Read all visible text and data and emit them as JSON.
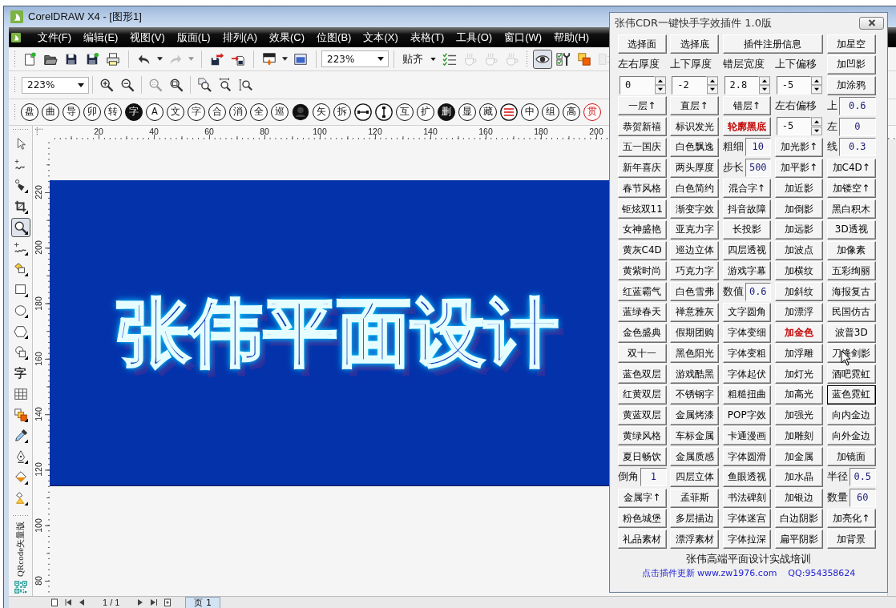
{
  "window": {
    "title": "CorelDRAW X4 - [图形1]"
  },
  "menu_bar": [
    "文件(F)",
    "编辑(E)",
    "视图(V)",
    "版面(L)",
    "排列(A)",
    "效果(C)",
    "位图(B)",
    "文本(X)",
    "表格(T)",
    "工具(O)",
    "窗口(W)",
    "帮助(H)"
  ],
  "standard_toolbar": [
    {
      "kind": "new-document",
      "disabled": false,
      "pressed": false
    },
    {
      "kind": "folder",
      "disabled": false,
      "pressed": false
    },
    {
      "kind": "floppy",
      "disabled": false,
      "pressed": false
    },
    {
      "kind": "floppy-plus",
      "disabled": false,
      "pressed": false
    },
    {
      "kind": "printer",
      "disabled": false,
      "pressed": false
    },
    {
      "kind": "separator"
    },
    {
      "kind": "undo-arrow",
      "disabled": false,
      "pressed": false
    },
    {
      "kind": "caret",
      "disabled": false
    },
    {
      "kind": "redo-arrow",
      "disabled": true,
      "pressed": false
    },
    {
      "kind": "caret",
      "disabled": true
    },
    {
      "kind": "separator"
    },
    {
      "kind": "floppy-arrow",
      "disabled": false,
      "pressed": false
    },
    {
      "kind": "page-arrow",
      "disabled": false,
      "pressed": false
    },
    {
      "kind": "separator"
    },
    {
      "kind": "screen-flame",
      "disabled": false,
      "pressed": false
    },
    {
      "kind": "caret",
      "disabled": false
    },
    {
      "kind": "window",
      "disabled": false,
      "pressed": false
    },
    {
      "kind": "separator"
    },
    {
      "kind": "combo",
      "value": "223%"
    },
    {
      "kind": "separator"
    },
    {
      "kind": "menu",
      "label": "贴齐"
    },
    {
      "kind": "checklist",
      "disabled": false,
      "pressed": false
    },
    {
      "kind": "cup",
      "disabled": true,
      "pressed": false
    },
    {
      "kind": "cup",
      "disabled": true,
      "pressed": false
    },
    {
      "kind": "cup",
      "disabled": true,
      "pressed": false
    },
    {
      "kind": "grip"
    },
    {
      "kind": "eye",
      "disabled": false,
      "pressed": true
    },
    {
      "kind": "checklist-wrench",
      "disabled": false,
      "pressed": false
    },
    {
      "kind": "overlap-squares",
      "disabled": false,
      "pressed": false
    },
    {
      "kind": "side-panel",
      "disabled": true,
      "pressed": false
    }
  ],
  "zoom_toolbar": [
    {
      "kind": "combo",
      "value": "223%"
    },
    {
      "kind": "separator"
    },
    {
      "kind": "magnifier-plus",
      "disabled": false,
      "pressed": false
    },
    {
      "kind": "magnifier-minus",
      "disabled": false,
      "pressed": false
    },
    {
      "kind": "separator"
    },
    {
      "kind": "magnifier-grid",
      "disabled": true,
      "pressed": false
    },
    {
      "kind": "magnifier-rect",
      "disabled": false,
      "pressed": false
    },
    {
      "kind": "separator"
    },
    {
      "kind": "page-magnifier",
      "disabled": false,
      "pressed": false
    },
    {
      "kind": "magnifier-hbar",
      "disabled": false,
      "pressed": false
    },
    {
      "kind": "magnifier-vbar",
      "disabled": false,
      "pressed": false
    }
  ],
  "symbol_toolbar": [
    {
      "kind": "char",
      "text": "盘"
    },
    {
      "kind": "char",
      "text": "曲"
    },
    {
      "kind": "char",
      "text": "导"
    },
    {
      "kind": "char",
      "text": "卯"
    },
    {
      "kind": "char",
      "text": "转"
    },
    {
      "kind": "filled",
      "text": "字"
    },
    {
      "kind": "char",
      "text": "A"
    },
    {
      "kind": "char",
      "text": "文"
    },
    {
      "kind": "char",
      "text": "字"
    },
    {
      "kind": "char",
      "text": "合"
    },
    {
      "kind": "char",
      "text": "消"
    },
    {
      "kind": "char",
      "text": "全"
    },
    {
      "kind": "char",
      "text": "巡"
    },
    {
      "kind": "person"
    },
    {
      "kind": "char",
      "text": "矢"
    },
    {
      "kind": "char",
      "text": "拆"
    },
    {
      "kind": "link"
    },
    {
      "kind": "ibeam"
    },
    {
      "kind": "char",
      "text": "互"
    },
    {
      "kind": "char",
      "text": "扩"
    },
    {
      "kind": "filled",
      "text": "删"
    },
    {
      "kind": "char",
      "text": "显"
    },
    {
      "kind": "char",
      "text": "藏"
    },
    {
      "kind": "lines"
    },
    {
      "kind": "char",
      "text": "中"
    },
    {
      "kind": "char",
      "text": "组"
    },
    {
      "kind": "char",
      "text": "高"
    },
    {
      "kind": "red",
      "text": "贯"
    }
  ],
  "toolbox": [
    {
      "kind": "arrow-pointer",
      "selected": false
    },
    {
      "kind": "node-squiggle",
      "selected": false
    },
    {
      "kind": "nib-node",
      "selected": false
    },
    {
      "kind": "crop",
      "selected": false
    },
    {
      "kind": "magnifier",
      "selected": true
    },
    {
      "kind": "squiggle",
      "selected": false
    },
    {
      "kind": "bucket-square",
      "selected": false
    },
    {
      "kind": "rectangle",
      "selected": false
    },
    {
      "kind": "ellipse",
      "selected": false
    },
    {
      "kind": "hexagon",
      "selected": false
    },
    {
      "kind": "circle-square",
      "selected": false
    },
    {
      "kind": "text",
      "label": "字",
      "selected": false
    },
    {
      "kind": "grid",
      "selected": false
    },
    {
      "kind": "stacked-squares",
      "selected": false
    },
    {
      "kind": "eyedropper",
      "selected": false
    },
    {
      "kind": "pen-nib",
      "selected": false
    },
    {
      "kind": "paint-bucket",
      "selected": false
    },
    {
      "kind": "bucket-triangle",
      "selected": false
    }
  ],
  "toolbox_plugin": {
    "label": "QRcode矢量版"
  },
  "rulers": {
    "horizontal": [
      "20",
      "40",
      "60",
      "80",
      "100",
      "120",
      "140",
      "160",
      "180",
      "200"
    ],
    "vertical": [
      "220",
      "200",
      "180",
      "160",
      "140",
      "120",
      "100",
      "80"
    ]
  },
  "canvas": {
    "artwork_text": "张伟平面设计"
  },
  "page_navigator": {
    "page_count": "1 / 1",
    "page_tab": "页 1"
  },
  "plugin_panel": {
    "title": "张伟CDR一键快手字效插件 1.0版",
    "rows": [
      [
        {
          "kind": "button",
          "label": "选择面",
          "focused": false
        },
        {
          "kind": "button",
          "label": "选择底",
          "focused": false
        },
        {
          "kind": "button",
          "label": "插件注册信息",
          "focused": false,
          "colspan": 2
        },
        {
          "kind": "button",
          "label": "加星空",
          "focused": false
        }
      ],
      [
        {
          "kind": "label",
          "label": "左右厚度"
        },
        {
          "kind": "label",
          "label": "上下厚度"
        },
        {
          "kind": "label",
          "label": "错层宽度"
        },
        {
          "kind": "label",
          "label": "上下偏移"
        },
        {
          "kind": "button",
          "label": "加凹影",
          "focused": false
        }
      ],
      [
        {
          "kind": "spinner",
          "value": "0"
        },
        {
          "kind": "spinner",
          "value": "-2"
        },
        {
          "kind": "spinner",
          "value": "2.8"
        },
        {
          "kind": "spinner",
          "value": "-5"
        },
        {
          "kind": "button",
          "label": "加涂鸦",
          "focused": false
        }
      ],
      [
        {
          "kind": "button",
          "label": "一层↑",
          "focused": false
        },
        {
          "kind": "button",
          "label": "直层↑",
          "focused": false
        },
        {
          "kind": "button",
          "label": "错层↑",
          "focused": false
        },
        {
          "kind": "label",
          "label": "左右偏移"
        },
        {
          "kind": "field",
          "label": "上",
          "value": "0.6"
        }
      ],
      [
        {
          "kind": "button",
          "label": "恭贺新禧",
          "focused": false
        },
        {
          "kind": "button",
          "label": "标识发光",
          "focused": false
        },
        {
          "kind": "button",
          "label": "轮廓黑底",
          "focused": false,
          "color": "#c00000"
        },
        {
          "kind": "spinner",
          "value": "-5"
        },
        {
          "kind": "field",
          "label": "左",
          "value": "0"
        }
      ],
      [
        {
          "kind": "button",
          "label": "五一国庆",
          "focused": false
        },
        {
          "kind": "button",
          "label": "白色飘逸",
          "focused": false
        },
        {
          "kind": "field",
          "label": "粗细",
          "value": "10"
        },
        {
          "kind": "button",
          "label": "加光影↑",
          "focused": false
        },
        {
          "kind": "field",
          "label": "线",
          "value": "0.3"
        }
      ],
      [
        {
          "kind": "button",
          "label": "新年喜庆",
          "focused": false
        },
        {
          "kind": "button",
          "label": "两头厚度",
          "focused": false
        },
        {
          "kind": "field",
          "label": "步长",
          "value": "500"
        },
        {
          "kind": "button",
          "label": "加平影↑",
          "focused": false
        },
        {
          "kind": "button",
          "label": "加C4D↑",
          "focused": false
        }
      ],
      [
        {
          "kind": "button",
          "label": "春节风格",
          "focused": false
        },
        {
          "kind": "button",
          "label": "白色简约",
          "focused": false
        },
        {
          "kind": "button",
          "label": "混合字↑",
          "focused": false
        },
        {
          "kind": "button",
          "label": "加近影",
          "focused": false
        },
        {
          "kind": "button",
          "label": "加镂空↑",
          "focused": false
        }
      ],
      [
        {
          "kind": "button",
          "label": "钜炫双11",
          "focused": false
        },
        {
          "kind": "button",
          "label": "渐变字效",
          "focused": false
        },
        {
          "kind": "button",
          "label": "抖音故障",
          "focused": false
        },
        {
          "kind": "button",
          "label": "加倒影",
          "focused": false
        },
        {
          "kind": "button",
          "label": "黑白积木",
          "focused": false
        }
      ],
      [
        {
          "kind": "button",
          "label": "女神盛艳",
          "focused": false
        },
        {
          "kind": "button",
          "label": "亚克力字",
          "focused": false
        },
        {
          "kind": "button",
          "label": "长投影",
          "focused": false
        },
        {
          "kind": "button",
          "label": "加远影",
          "focused": false
        },
        {
          "kind": "button",
          "label": "3D透视",
          "focused": false
        }
      ],
      [
        {
          "kind": "button",
          "label": "黄灰C4D",
          "focused": false
        },
        {
          "kind": "button",
          "label": "巡边立体",
          "focused": false
        },
        {
          "kind": "button",
          "label": "四层透视",
          "focused": false
        },
        {
          "kind": "button",
          "label": "加波点",
          "focused": false
        },
        {
          "kind": "button",
          "label": "加像素",
          "focused": false
        }
      ],
      [
        {
          "kind": "button",
          "label": "黄紫时尚",
          "focused": false
        },
        {
          "kind": "button",
          "label": "巧克力字",
          "focused": false
        },
        {
          "kind": "button",
          "label": "游戏字幕",
          "focused": false
        },
        {
          "kind": "button",
          "label": "加横纹",
          "focused": false
        },
        {
          "kind": "button",
          "label": "五彩绚丽",
          "focused": false
        }
      ],
      [
        {
          "kind": "button",
          "label": "红蓝霸气",
          "focused": false
        },
        {
          "kind": "button",
          "label": "白色雪弗",
          "focused": false
        },
        {
          "kind": "field",
          "label": "数值",
          "value": "0.6"
        },
        {
          "kind": "button",
          "label": "加斜纹",
          "focused": false
        },
        {
          "kind": "button",
          "label": "海报复古",
          "focused": false
        }
      ],
      [
        {
          "kind": "button",
          "label": "蓝绿春天",
          "focused": false
        },
        {
          "kind": "button",
          "label": "禅意雅灰",
          "focused": false
        },
        {
          "kind": "button",
          "label": "文字圆角",
          "focused": false
        },
        {
          "kind": "button",
          "label": "加漂浮",
          "focused": false
        },
        {
          "kind": "button",
          "label": "民国仿古",
          "focused": false
        }
      ],
      [
        {
          "kind": "button",
          "label": "金色盛典",
          "focused": false
        },
        {
          "kind": "button",
          "label": "假期团购",
          "focused": false
        },
        {
          "kind": "button",
          "label": "字体变细",
          "focused": false
        },
        {
          "kind": "button",
          "label": "加金色",
          "focused": false,
          "color": "#c00000"
        },
        {
          "kind": "button",
          "label": "波普3D",
          "focused": false
        }
      ],
      [
        {
          "kind": "button",
          "label": "双十一",
          "focused": false
        },
        {
          "kind": "button",
          "label": "黑色阳光",
          "focused": false
        },
        {
          "kind": "button",
          "label": "字体变粗",
          "focused": false
        },
        {
          "kind": "button",
          "label": "加浮雕",
          "focused": false
        },
        {
          "kind": "button",
          "label": "刀锋剑影",
          "focused": false
        }
      ],
      [
        {
          "kind": "button",
          "label": "蓝色双层",
          "focused": false
        },
        {
          "kind": "button",
          "label": "游戏酷黑",
          "focused": false
        },
        {
          "kind": "button",
          "label": "字体起伏",
          "focused": false
        },
        {
          "kind": "button",
          "label": "加灯光",
          "focused": false
        },
        {
          "kind": "button",
          "label": "酒吧霓虹",
          "focused": false
        }
      ],
      [
        {
          "kind": "button",
          "label": "红黄双层",
          "focused": false
        },
        {
          "kind": "button",
          "label": "不锈钢字",
          "focused": false
        },
        {
          "kind": "button",
          "label": "粗糙扭曲",
          "focused": false
        },
        {
          "kind": "button",
          "label": "加高光",
          "focused": false
        },
        {
          "kind": "button",
          "label": "蓝色霓虹",
          "focused": true
        }
      ],
      [
        {
          "kind": "button",
          "label": "黄蓝双层",
          "focused": false
        },
        {
          "kind": "button",
          "label": "金属烤漆",
          "focused": false
        },
        {
          "kind": "button",
          "label": "POP字效",
          "focused": false
        },
        {
          "kind": "button",
          "label": "加强光",
          "focused": false
        },
        {
          "kind": "button",
          "label": "向内金边",
          "focused": false
        }
      ],
      [
        {
          "kind": "button",
          "label": "黄绿风格",
          "focused": false
        },
        {
          "kind": "button",
          "label": "车标金属",
          "focused": false
        },
        {
          "kind": "button",
          "label": "卡通漫画",
          "focused": false
        },
        {
          "kind": "button",
          "label": "加雕刻",
          "focused": false
        },
        {
          "kind": "button",
          "label": "向外金边",
          "focused": false
        }
      ],
      [
        {
          "kind": "button",
          "label": "夏日畅饮",
          "focused": false
        },
        {
          "kind": "button",
          "label": "金属质感",
          "focused": false
        },
        {
          "kind": "button",
          "label": "字体圆滑",
          "focused": false
        },
        {
          "kind": "button",
          "label": "加金属",
          "focused": false
        },
        {
          "kind": "button",
          "label": "加镜面",
          "focused": false
        }
      ],
      [
        {
          "kind": "field",
          "label": "倒角",
          "value": "1"
        },
        {
          "kind": "button",
          "label": "四层立体",
          "focused": false
        },
        {
          "kind": "button",
          "label": "鱼眼透视",
          "focused": false
        },
        {
          "kind": "button",
          "label": "加水晶",
          "focused": false
        },
        {
          "kind": "field",
          "label": "半径",
          "value": "0.5"
        }
      ],
      [
        {
          "kind": "button",
          "label": "金属字↑",
          "focused": false
        },
        {
          "kind": "button",
          "label": "孟菲斯",
          "focused": false
        },
        {
          "kind": "button",
          "label": "书法碑刻",
          "focused": false
        },
        {
          "kind": "button",
          "label": "加银边",
          "focused": false
        },
        {
          "kind": "field",
          "label": "数量",
          "value": "60"
        }
      ],
      [
        {
          "kind": "button",
          "label": "粉色城堡",
          "focused": false
        },
        {
          "kind": "button",
          "label": "多层描边",
          "focused": false
        },
        {
          "kind": "button",
          "label": "字体迷宫",
          "focused": false
        },
        {
          "kind": "button",
          "label": "白边阴影",
          "focused": false
        },
        {
          "kind": "button",
          "label": "加亮化↑",
          "focused": false
        }
      ],
      [
        {
          "kind": "button",
          "label": "礼品素材",
          "focused": false
        },
        {
          "kind": "button",
          "label": "漂浮素材",
          "focused": false
        },
        {
          "kind": "button",
          "label": "字体拉深",
          "focused": false
        },
        {
          "kind": "button",
          "label": "扁平阴影",
          "focused": false
        },
        {
          "kind": "button",
          "label": "加背景",
          "focused": false
        }
      ]
    ],
    "footer": {
      "heading": "张伟高端平面设计实战培训",
      "update_link": "点击插件更新 www.zw1976.com",
      "contact": "QQ:954358624"
    }
  }
}
